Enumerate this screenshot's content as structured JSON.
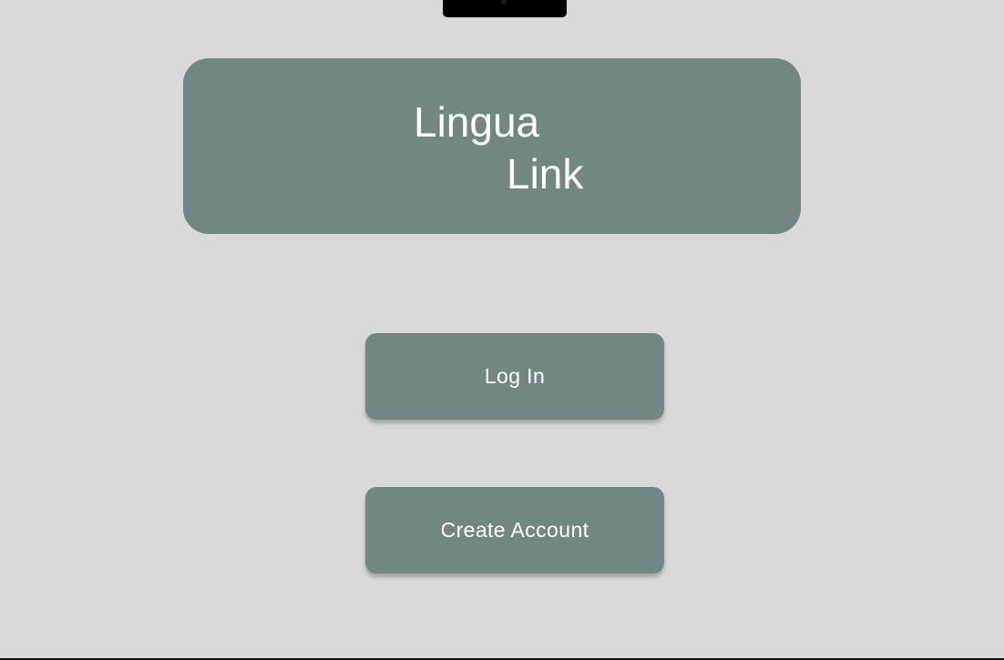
{
  "logo": {
    "line1": "Lingua",
    "line2": "Link"
  },
  "buttons": {
    "login": "Log In",
    "create_account": "Create Account"
  },
  "colors": {
    "background": "#d9d9d9",
    "card": "#728784",
    "text": "#ffffff"
  }
}
